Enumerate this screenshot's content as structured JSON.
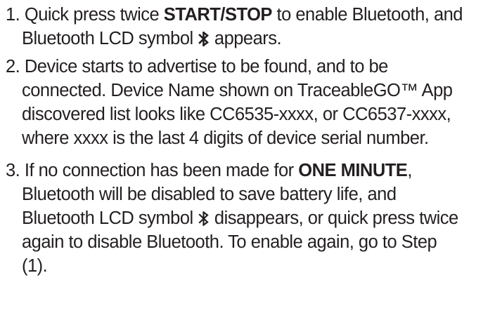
{
  "steps": [
    {
      "number": "1.",
      "line1_pre": "Quick press twice ",
      "line1_bold": "START/STOP",
      "line1_post": " to enable Bluetooth, and",
      "line2_pre": "Bluetooth LCD symbol ",
      "icon": "bluetooth-symbol-icon",
      "line2_post": " appears."
    },
    {
      "number": "2.",
      "lines": [
        "Device starts to advertise to be found, and to be",
        "connected. Device Name shown on TraceableGO™ App",
        "discovered list looks like CC6535-xxxx, or CC6537-xxxx,",
        "where xxxx is the last 4 digits of device serial number."
      ]
    },
    {
      "number": "3.",
      "line1_pre": "If no connection has been made for ",
      "line1_bold": "ONE MINUTE",
      "line1_post": ",",
      "line2": "Bluetooth will be disabled to save battery life, and",
      "line3_pre": "Bluetooth LCD symbol ",
      "icon": "bluetooth-symbol-icon",
      "line3_post": " disappears, or quick press twice",
      "line4": "again to disable Bluetooth. To enable again, go to Step",
      "line5": "(1)."
    }
  ]
}
